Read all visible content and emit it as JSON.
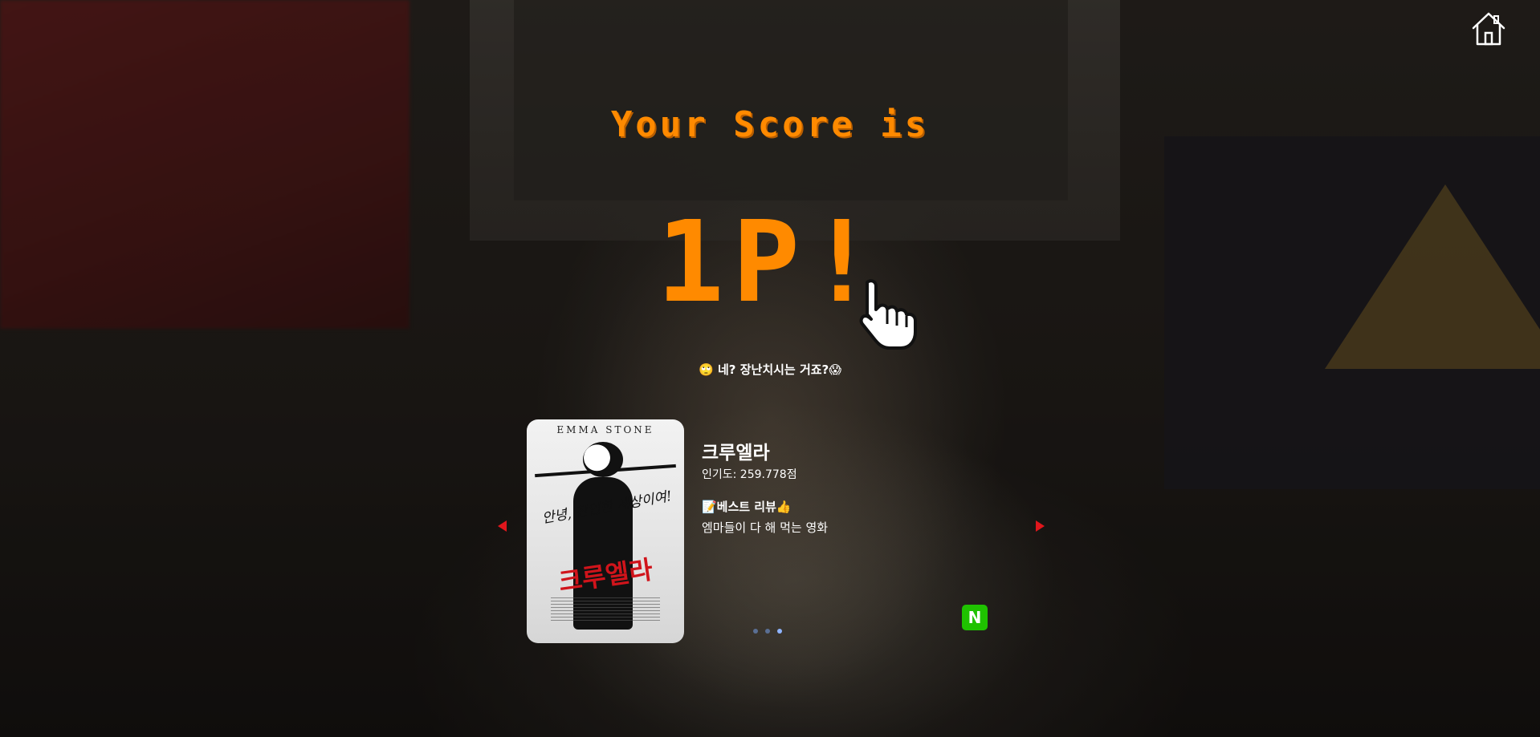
{
  "header": {
    "home_icon": "home-icon"
  },
  "result": {
    "score_label": "Your Score is",
    "score_value": "1P!",
    "comment": "🙄 네? 장난치시는 거죠?😱",
    "accent_color": "#ff8a00"
  },
  "carousel": {
    "prev_icon": "triangle-left-icon",
    "next_icon": "triangle-right-icon",
    "slides_count": 3,
    "active_index": 2,
    "movie": {
      "title": "크루엘라",
      "popularity": "인기도: 259.778점",
      "review_header": "📝베스트 리뷰👍",
      "review_text": "엠마들이 다 해 먹는 영화",
      "poster": {
        "actor": "EMMA STONE",
        "tagline": "안녕, 잔인한 세상이여!",
        "title": "크루엘라"
      }
    },
    "naver_label": "N",
    "naver_color": "#1fc200"
  }
}
